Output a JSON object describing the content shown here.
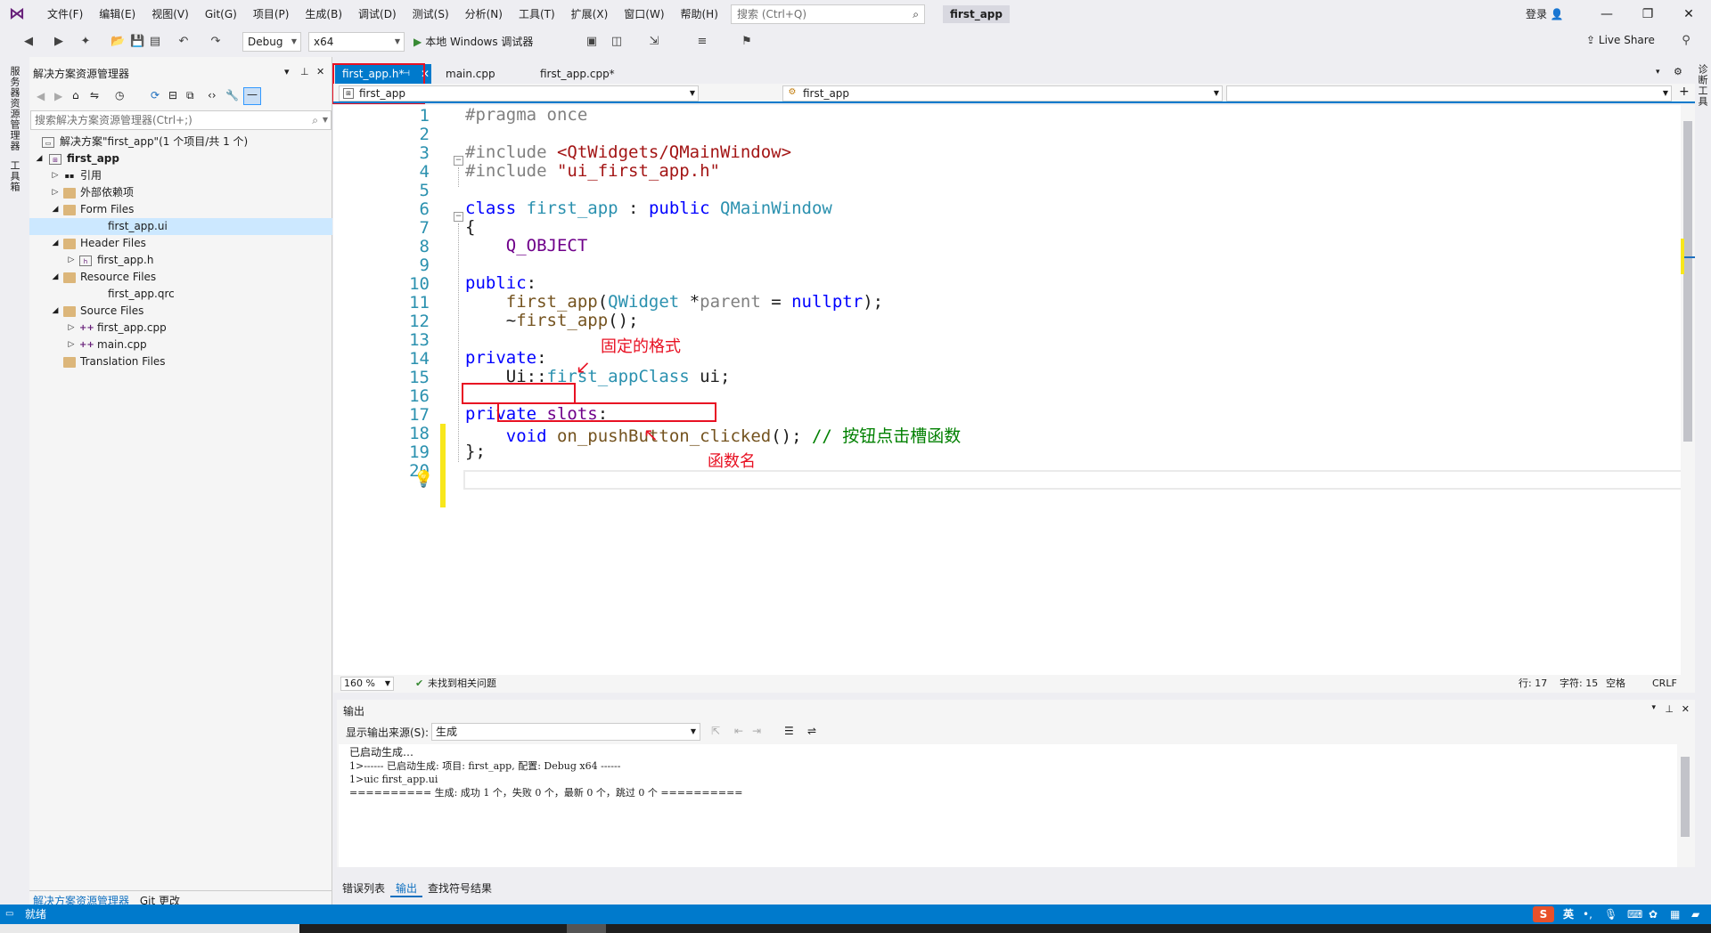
{
  "titlebar": {
    "menu": [
      "文件(F)",
      "编辑(E)",
      "视图(V)",
      "Git(G)",
      "项目(P)",
      "生成(B)",
      "调试(D)",
      "测试(S)",
      "分析(N)",
      "工具(T)",
      "扩展(X)",
      "窗口(W)",
      "帮助(H)"
    ],
    "search_placeholder": "搜索 (Ctrl+Q)",
    "app_name": "first_app",
    "login": "登录"
  },
  "toolbar": {
    "config": "Debug",
    "platform": "x64",
    "run_label": "本地 Windows 调试器",
    "live_share": "Live Share"
  },
  "left_strip": {
    "server_explorer": "服务器资源管理器",
    "toolbox": "工具箱"
  },
  "right_strip": {
    "diagnostics": "诊断工具"
  },
  "solution_explorer": {
    "title": "解决方案资源管理器",
    "search_placeholder": "搜索解决方案资源管理器(Ctrl+;)",
    "tree": [
      {
        "label": "解决方案\"first_app\"(1 个项目/共 1 个)",
        "level": 0,
        "icon": "solution"
      },
      {
        "label": "first_app",
        "level": 1,
        "icon": "project",
        "bold": true
      },
      {
        "label": "引用",
        "level": 2,
        "icon": "references"
      },
      {
        "label": "外部依赖项",
        "level": 2,
        "icon": "folder"
      },
      {
        "label": "Form Files",
        "level": 2,
        "icon": "folder"
      },
      {
        "label": "first_app.ui",
        "level": 3,
        "icon": "file",
        "selected": true
      },
      {
        "label": "Header Files",
        "level": 2,
        "icon": "folder"
      },
      {
        "label": "first_app.h",
        "level": 3,
        "icon": "header"
      },
      {
        "label": "Resource Files",
        "level": 2,
        "icon": "folder"
      },
      {
        "label": "first_app.qrc",
        "level": 3,
        "icon": "file"
      },
      {
        "label": "Source Files",
        "level": 2,
        "icon": "folder"
      },
      {
        "label": "first_app.cpp",
        "level": 3,
        "icon": "cpp"
      },
      {
        "label": "main.cpp",
        "level": 3,
        "icon": "cpp"
      },
      {
        "label": "Translation Files",
        "level": 2,
        "icon": "folder"
      }
    ],
    "bottom_tabs": [
      "解决方案资源管理器",
      "Git 更改"
    ]
  },
  "editor": {
    "tabs": [
      "first_app.h*",
      "main.cpp",
      "first_app.cpp*"
    ],
    "nav_left": "first_app",
    "nav_mid": "first_app",
    "line_numbers": [
      "1",
      "2",
      "3",
      "4",
      "5",
      "6",
      "7",
      "8",
      "9",
      "10",
      "11",
      "12",
      "13",
      "14",
      "15",
      "16",
      "17",
      "18",
      "19",
      "20"
    ],
    "annotation_format": "固定的格式",
    "annotation_funcname": "函数名",
    "zoom": "160 %",
    "issues": "未找到相关问题",
    "row": "行: 17",
    "col": "字符: 15",
    "spaces": "空格",
    "eol": "CRLF"
  },
  "output": {
    "title": "输出",
    "source_label": "显示输出来源(S):",
    "source_value": "生成",
    "lines": [
      "已启动生成…",
      "1>------ 已启动生成: 项目: first_app, 配置: Debug x64 ------",
      "1>uic first_app.ui",
      "========== 生成: 成功 1 个，失败 0 个，最新 0 个，跳过 0 个 =========="
    ]
  },
  "bottom_tabs": [
    "错误列表",
    "输出",
    "查找符号结果"
  ],
  "status": {
    "ready": "就绪",
    "ime": "英"
  },
  "colors": {
    "accent": "#007acc",
    "annotation_red": "#e81123"
  }
}
